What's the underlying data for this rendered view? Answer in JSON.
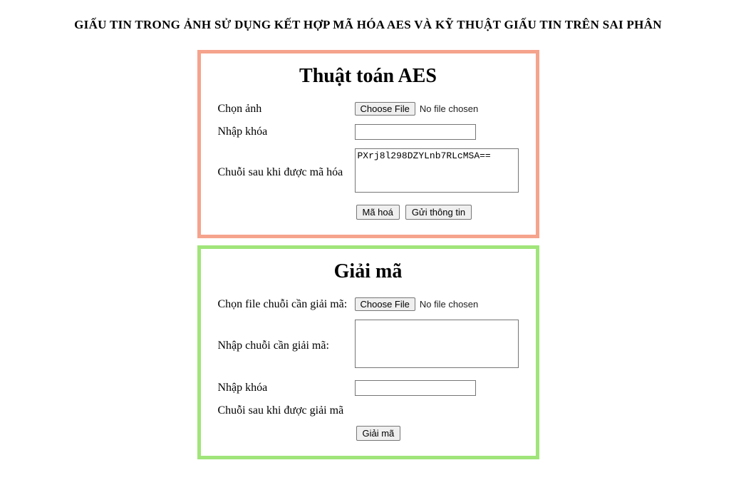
{
  "page": {
    "title": "GIẤU TIN TRONG ẢNH SỬ DỤNG KẾT HỢP MÃ HÓA AES VÀ KỸ THUẬT GIẤU TIN TRÊN SAI PHÂN"
  },
  "encode": {
    "heading": "Thuật toán AES",
    "choose_image_label": "Chọn ảnh",
    "choose_file_button": "Choose File",
    "no_file_text": "No file chosen",
    "key_label": "Nhập khóa",
    "key_value": "",
    "encrypted_label": "Chuỗi sau khi được mã hóa",
    "encrypted_value": "PXrj8l298DZYLnb7RLcMSA==",
    "encrypt_button": "Mã hoá",
    "send_button": "Gửi thông tin"
  },
  "decode": {
    "heading": "Giải mã",
    "choose_file_label": "Chọn file chuỗi cần giải mã:",
    "choose_file_button": "Choose File",
    "no_file_text": "No file chosen",
    "input_string_label": "Nhập chuỗi cần giải mã:",
    "input_string_value": "",
    "key_label": "Nhập khóa",
    "key_value": "",
    "decrypted_label": "Chuỗi sau khi được giải mã",
    "decrypted_value": "",
    "decrypt_button": "Giải mã"
  }
}
